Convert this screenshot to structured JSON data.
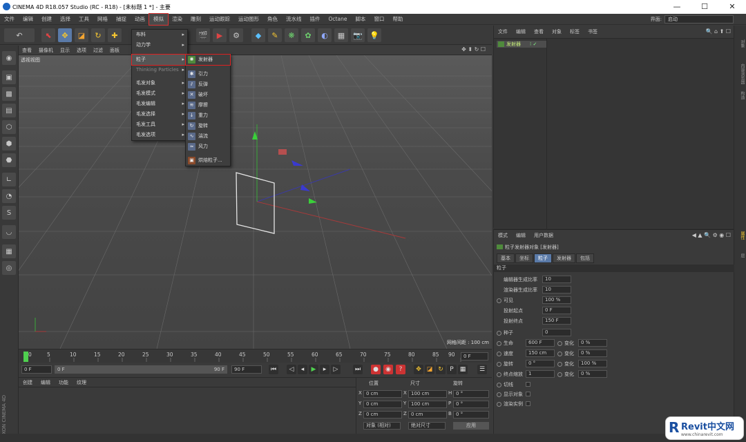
{
  "title": "CINEMA 4D R18.057 Studio (RC - R18) - [未标题 1 *] - 主要",
  "window_controls": [
    "—",
    "☐",
    "✕"
  ],
  "menubar": [
    "文件",
    "编辑",
    "创建",
    "选择",
    "工具",
    "网格",
    "捕捉",
    "动画",
    "模拟",
    "渲染",
    "雕刻",
    "运动跟踪",
    "运动图形",
    "角色",
    "流水线",
    "插件",
    "Octane",
    "脚本",
    "窗口",
    "帮助"
  ],
  "layout": {
    "label": "界面:",
    "value": "启动"
  },
  "viewport": {
    "menu": [
      "查看",
      "摄像机",
      "显示",
      "选项",
      "过滤",
      "面板"
    ],
    "label": "透视视图",
    "grid_label": "网格间距 : 100 cm"
  },
  "sim_menu": {
    "items": [
      {
        "label": "布料",
        "arrow": true
      },
      {
        "label": "动力学",
        "arrow": true
      },
      {
        "label": "粒子",
        "arrow": true
      },
      {
        "label": "Thinking Particles",
        "arrow": true
      },
      {
        "label": "毛发对象",
        "arrow": true
      },
      {
        "label": "毛发模式",
        "arrow": true
      },
      {
        "label": "毛发编辑",
        "arrow": true
      },
      {
        "label": "毛发选择",
        "arrow": true
      },
      {
        "label": "毛发工具",
        "arrow": true
      },
      {
        "label": "毛发选项",
        "arrow": true
      }
    ]
  },
  "particle_menu": {
    "items": [
      "发射器",
      "引力",
      "反弹",
      "破坏",
      "摩擦",
      "重力",
      "旋转",
      "湍流",
      "风力",
      "烘焙粒子..."
    ]
  },
  "timeline": {
    "ticks": [
      "0",
      "5",
      "10",
      "15",
      "20",
      "25",
      "30",
      "35",
      "40",
      "45",
      "50",
      "55",
      "60",
      "65",
      "70",
      "75",
      "80",
      "85",
      "90"
    ],
    "current": "0 F"
  },
  "transport": {
    "start": "0 F",
    "slider_start": "0 F",
    "slider_end": "90 F",
    "end": "90 F"
  },
  "material": {
    "menu": [
      "创建",
      "编辑",
      "功能",
      "纹理"
    ]
  },
  "coords": {
    "headers": [
      "位置",
      "尺寸",
      "旋转"
    ],
    "rows": [
      {
        "axis": "X",
        "pos": "0 cm",
        "size_axis": "X",
        "size": "100 cm",
        "rot_axis": "H",
        "rot": "0 °"
      },
      {
        "axis": "Y",
        "pos": "0 cm",
        "size_axis": "Y",
        "size": "100 cm",
        "rot_axis": "P",
        "rot": "0 °"
      },
      {
        "axis": "Z",
        "pos": "0 cm",
        "size_axis": "Z",
        "size": "0 cm",
        "rot_axis": "B",
        "rot": "0 °"
      }
    ],
    "mode": "对象 (相对)",
    "size_mode": "绝对尺寸",
    "apply": "应用"
  },
  "objects": {
    "menu": [
      "文件",
      "编辑",
      "查看",
      "对象",
      "标签",
      "书签"
    ],
    "item": "发射器"
  },
  "right_strip": [
    "对象",
    "内容浏览器",
    "构造",
    "属性",
    "层"
  ],
  "attributes": {
    "menu": [
      "模式",
      "编辑",
      "用户数据"
    ],
    "object": "粒子发射器对象 [发射器]",
    "tabs": [
      "基本",
      "坐标",
      "粒子",
      "发射器",
      "包括"
    ],
    "active_tab": "粒子",
    "section": "粒子",
    "rows": [
      {
        "label": "编辑器生成比率",
        "value": "10"
      },
      {
        "label": "渲染器生成比率",
        "value": "10"
      },
      {
        "label": "可见",
        "value": "100 %"
      },
      {
        "label": "投射起点",
        "value": "0 F"
      },
      {
        "label": "投射终点",
        "value": "150 F"
      },
      {
        "label": "种子",
        "value": "0"
      }
    ],
    "pairs": [
      {
        "label": "生命",
        "value": "600 F",
        "var": "变化",
        "var_value": "0 %"
      },
      {
        "label": "速度",
        "value": "150 cm",
        "var": "变化",
        "var_value": "0 %"
      },
      {
        "label": "旋转",
        "value": "0 °",
        "var": "变化",
        "var_value": "100 %"
      },
      {
        "label": "终点缩放",
        "value": "1",
        "var": "变化",
        "var_value": "0 %"
      }
    ],
    "checks": [
      "切线",
      "显示对象",
      "渲染实例"
    ]
  },
  "branding": {
    "side": "MAXON CINEMA 4D",
    "wm_title": "Revit中文网",
    "wm_url": "www.chinarevit.com",
    "wm_letter": "R"
  }
}
